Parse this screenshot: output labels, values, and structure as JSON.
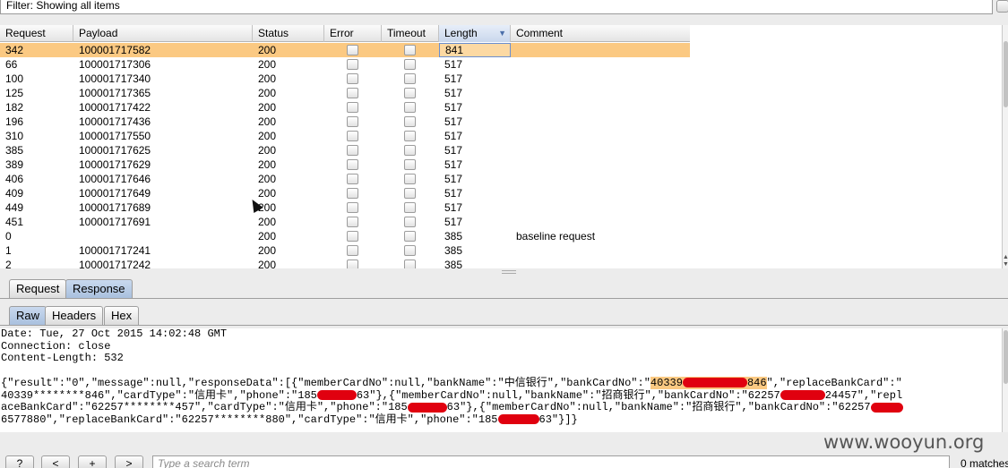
{
  "filter": {
    "text": "Filter: Showing all items"
  },
  "table": {
    "columns": [
      "Request",
      "Payload",
      "Status",
      "Error",
      "Timeout",
      "Length",
      "Comment"
    ],
    "sorted_column": "Length",
    "rows": [
      {
        "request": "342",
        "payload": "100001717582",
        "status": "200",
        "length": "841",
        "comment": "",
        "selected": true
      },
      {
        "request": "66",
        "payload": "100001717306",
        "status": "200",
        "length": "517",
        "comment": ""
      },
      {
        "request": "100",
        "payload": "100001717340",
        "status": "200",
        "length": "517",
        "comment": ""
      },
      {
        "request": "125",
        "payload": "100001717365",
        "status": "200",
        "length": "517",
        "comment": ""
      },
      {
        "request": "182",
        "payload": "100001717422",
        "status": "200",
        "length": "517",
        "comment": ""
      },
      {
        "request": "196",
        "payload": "100001717436",
        "status": "200",
        "length": "517",
        "comment": ""
      },
      {
        "request": "310",
        "payload": "100001717550",
        "status": "200",
        "length": "517",
        "comment": ""
      },
      {
        "request": "385",
        "payload": "100001717625",
        "status": "200",
        "length": "517",
        "comment": ""
      },
      {
        "request": "389",
        "payload": "100001717629",
        "status": "200",
        "length": "517",
        "comment": ""
      },
      {
        "request": "406",
        "payload": "100001717646",
        "status": "200",
        "length": "517",
        "comment": ""
      },
      {
        "request": "409",
        "payload": "100001717649",
        "status": "200",
        "length": "517",
        "comment": ""
      },
      {
        "request": "449",
        "payload": "100001717689",
        "status": "200",
        "length": "517",
        "comment": ""
      },
      {
        "request": "451",
        "payload": "100001717691",
        "status": "200",
        "length": "517",
        "comment": ""
      },
      {
        "request": "0",
        "payload": "",
        "status": "200",
        "length": "385",
        "comment": "baseline request"
      },
      {
        "request": "1",
        "payload": "100001717241",
        "status": "200",
        "length": "385",
        "comment": ""
      },
      {
        "request": "2",
        "payload": "100001717242",
        "status": "200",
        "length": "385",
        "comment": ""
      }
    ]
  },
  "tabs": {
    "request": "Request",
    "response": "Response"
  },
  "subtabs": {
    "raw": "Raw",
    "headers": "Headers",
    "hex": "Hex"
  },
  "response": {
    "line1": "Date: Tue, 27 Oct 2015 14:02:48 GMT",
    "line2": "Connection: close",
    "line3": "Content-Length: 532",
    "body1a": "{\"result\":\"0\",\"message\":null,\"responseData\":[{\"memberCardNo\":null,\"bankName\":\"中信银行\",\"bankCardNo\":\"",
    "body1_hl_a": "40339",
    "body1_hl_b": "846",
    "body1b": "\",\"replaceBankCard\":\"",
    "body2a": "40339********846\",\"cardType\":\"信用卡\",\"phone\":\"185",
    "body2b": "63\"},{\"memberCardNo\":null,\"bankName\":\"招商银行\",\"bankCardNo\":\"62257",
    "body2c": "24457\",\"repl",
    "body3a": "aceBankCard\":\"62257********457\",\"cardType\":\"信用卡\",\"phone\":\"185",
    "body3b": "63\"},{\"memberCardNo\":null,\"bankName\":\"招商银行\",\"bankCardNo\":\"62257",
    "body4a": "6577880\",\"replaceBankCard\":\"62257********880\",\"cardType\":\"信用卡\",\"phone\":\"185",
    "body4b": "63\"}]}"
  },
  "bottom": {
    "help": "?",
    "prev": "<",
    "add": "+",
    "next": ">",
    "search_placeholder": "Type a search term",
    "matches": "0 matches"
  },
  "watermark": "www.wooyun.org",
  "colors": {
    "selected_row": "#fbc982",
    "redaction": "#e0000f",
    "active_tab": "#a9c0de"
  }
}
